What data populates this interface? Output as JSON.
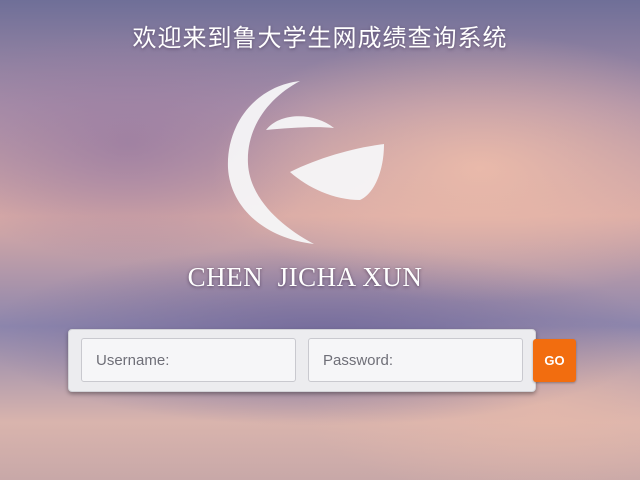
{
  "header": {
    "title": "欢迎来到鲁大学生网成绩查询系统"
  },
  "logo": {
    "icon": "crescent-logo-icon",
    "color": "#f5f5f7"
  },
  "brand": {
    "name": "CHEN  JICHA XUN"
  },
  "login": {
    "username_placeholder": "Username:",
    "username_value": "",
    "password_placeholder": "Password:",
    "password_value": "",
    "go_label": "GO",
    "go_color": "#f26d0f"
  }
}
